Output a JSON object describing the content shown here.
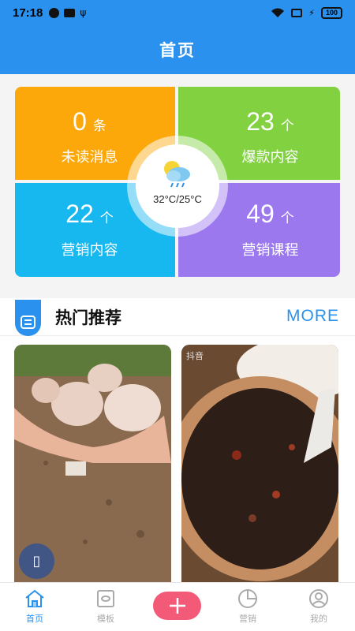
{
  "statusbar": {
    "time": "17:18",
    "battery": "100"
  },
  "header": {
    "title": "首页"
  },
  "stats": [
    {
      "value": "0",
      "unit": "条",
      "label": "未读消息",
      "color": "#fca80a"
    },
    {
      "value": "23",
      "unit": "个",
      "label": "爆款内容",
      "color": "#81d141"
    },
    {
      "value": "22",
      "unit": "个",
      "label": "营销内容",
      "color": "#17b7ef"
    },
    {
      "value": "49",
      "unit": "个",
      "label": "营销课程",
      "color": "#9c78ef"
    }
  ],
  "weather": {
    "temp": "32°C/25°C",
    "icon": "cloud-sun-rain-icon"
  },
  "hot": {
    "title": "热门推荐",
    "more": "MORE"
  },
  "cards": [
    {
      "icon": "shake-phone-icon"
    },
    {
      "watermark": "抖音"
    }
  ],
  "tabbar": {
    "home": "首页",
    "template": "模板",
    "marketing": "营销",
    "mine": "我的"
  },
  "accent": "#2a92ee",
  "add_color": "#f25a78"
}
